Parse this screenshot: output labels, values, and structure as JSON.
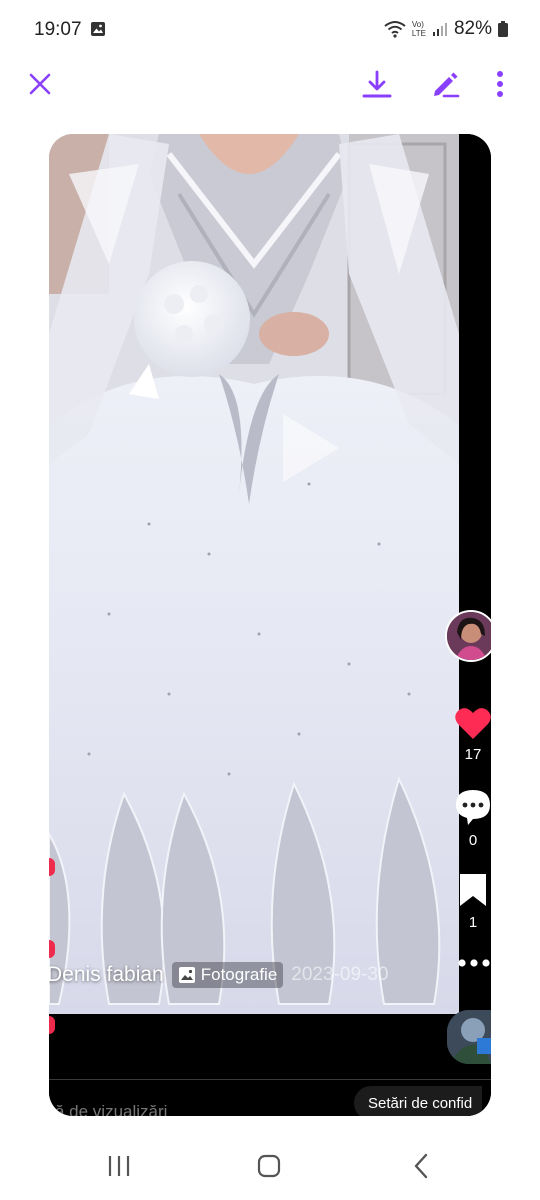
{
  "status_bar": {
    "time": "19:07",
    "battery": "82%",
    "network_label_top": "Vo)",
    "network_label_bottom": "LTE"
  },
  "toolbar": {
    "accent_color": "#8a3ffc",
    "close_icon": "close-icon",
    "download_icon": "download-icon",
    "edit_icon": "edit-icon",
    "more_icon": "more-vertical-icon"
  },
  "video": {
    "author": "Denis fabian",
    "type_badge": "Fotografie",
    "date": "2023-09-30"
  },
  "actions": {
    "likes": "17",
    "comments": "0",
    "saves": "1",
    "like_color": "#fe2c55"
  },
  "footer": {
    "views_text": "ă de vizualizări",
    "settings_label": "Setări de confid"
  }
}
